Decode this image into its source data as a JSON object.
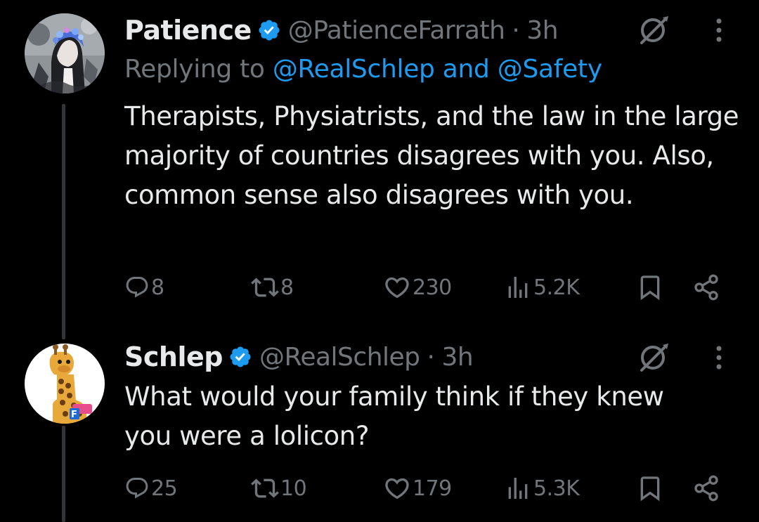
{
  "colors": {
    "background": "#000000",
    "text_primary": "#e7e9ea",
    "text_secondary": "#71767b",
    "link": "#1d9bf0",
    "verified": "#1d9bf0",
    "thread_line": "#333639"
  },
  "tweets": [
    {
      "author_name": "Patience",
      "handle": "@PatienceFarrath",
      "separator": "·",
      "time": "3h",
      "verified": true,
      "avatar_icon": "anime-character-avatar",
      "reply_prefix": "Replying to",
      "reply_mention_1": "@RealSchlep",
      "reply_conjunction": "and",
      "reply_mention_2": "@Safety",
      "text": "Therapists, Physiatrists, and the law in the large majority of countries disagrees with you. Also, common sense also disagrees with you.",
      "replies": "8",
      "retweets": "8",
      "likes": "230",
      "views": "5.2K"
    },
    {
      "author_name": "Schlep",
      "handle": "@RealSchlep",
      "separator": "·",
      "time": "3h",
      "verified": true,
      "avatar_icon": "giraffe-avatar",
      "text": "What would your family think if they knew you were a lolicon?",
      "replies": "25",
      "retweets": "10",
      "likes": "179",
      "views": "5.3K"
    }
  ]
}
